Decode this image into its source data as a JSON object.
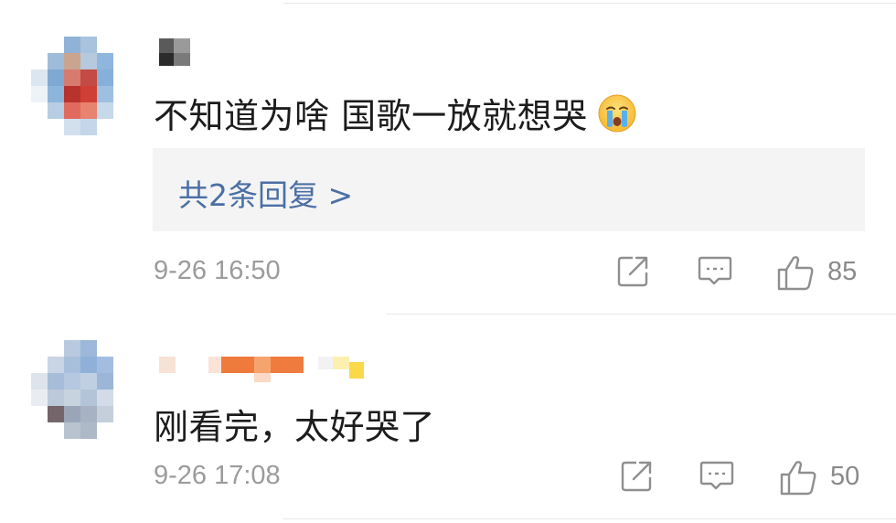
{
  "comments": [
    {
      "text": "不知道为啥 国歌一放就想哭",
      "emoji": "crying-face-icon",
      "replies_label": "共2条回复 >",
      "time": "9-26 16:50",
      "likes": "85"
    },
    {
      "text": "刚看完，太好哭了",
      "time": "9-26 17:08",
      "likes": "50"
    }
  ],
  "colors": {
    "reply_link": "#4a6fa5",
    "meta_text": "#9b9b9b",
    "reply_bg": "#f4f4f4",
    "divider": "#e8e8e8"
  }
}
